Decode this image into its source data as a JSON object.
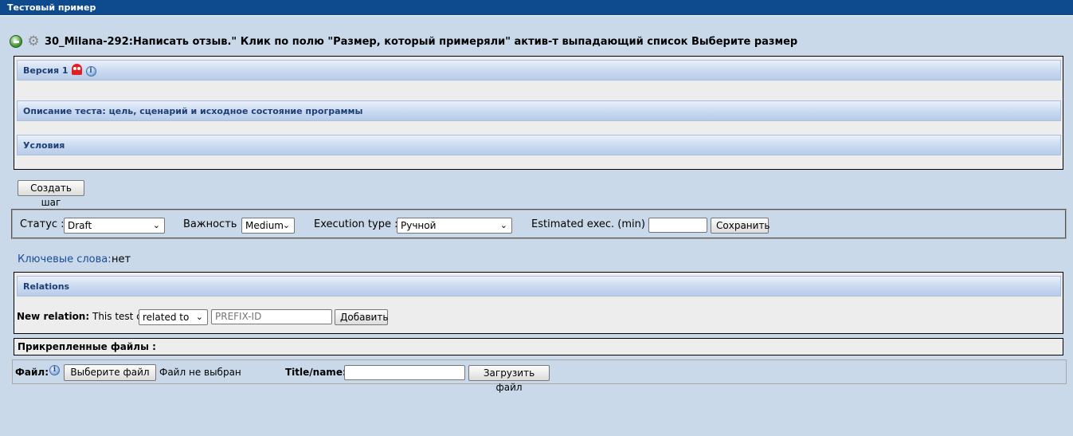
{
  "window": {
    "title": "Тестовый пример"
  },
  "heading": {
    "text": "30_Milana-292:Написать отзыв.\" Клик по полю \"Размер, который примеряли\" актив-т выпадающий список Выберите размер",
    "icons": [
      "green-arrow-icon",
      "gear-icon"
    ]
  },
  "sections": {
    "version": "Версия 1",
    "description": "Описание теста: цель, сценарий и исходное состояние программы",
    "conditions": "Условия"
  },
  "create_step_button": "Создать шаг",
  "properties": {
    "status_label": "Статус :",
    "status_value": "Draft",
    "importance_label": "Важность :",
    "importance_value": "Medium",
    "exec_type_label": "Execution type :",
    "exec_type_value": "Ручной",
    "estimated_label": "Estimated exec. (min) :",
    "estimated_value": "",
    "save_button": "Сохранить"
  },
  "keywords": {
    "label": "Ключевые слова",
    "value": "нет"
  },
  "relations": {
    "title": "Relations",
    "new_relation_label": "New relation:",
    "this_test_case": "This test case",
    "relation_type": "related to",
    "id_placeholder": "PREFIX-ID",
    "add_button": "Добавить"
  },
  "attachments": {
    "title": "Прикрепленные файлы :",
    "file_label": "Файл:",
    "choose_file_button": "Выберите файл",
    "no_file_text": "Файл не выбран",
    "title_name_label": "Title/name:",
    "title_name_value": "",
    "upload_button": "Загрузить файл"
  },
  "colors": {
    "title_bar": "#0e4a8e",
    "background": "#c9d9ea",
    "section_text": "#1d3f78",
    "keyword_label": "#1c4c98"
  }
}
